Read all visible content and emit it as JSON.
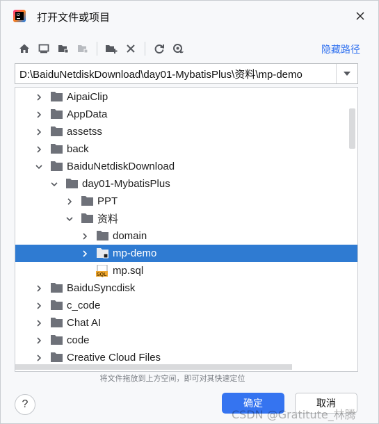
{
  "title": "打开文件或项目",
  "toolbar": {
    "hidden_path_label": "隐藏路径"
  },
  "path": {
    "value": "D:\\BaiduNetdiskDownload\\day01-MybatisPlus\\资料\\mp-demo"
  },
  "tree": {
    "items": [
      {
        "label": "AipaiClip"
      },
      {
        "label": "AppData"
      },
      {
        "label": "assetss"
      },
      {
        "label": "back"
      },
      {
        "label": "BaiduNetdiskDownload"
      },
      {
        "label": "day01-MybatisPlus"
      },
      {
        "label": "PPT"
      },
      {
        "label": "资料"
      },
      {
        "label": "domain"
      },
      {
        "label": "mp-demo"
      },
      {
        "label": "mp.sql"
      },
      {
        "label": "BaiduSyncdisk"
      },
      {
        "label": "c_code"
      },
      {
        "label": "Chat AI"
      },
      {
        "label": "code"
      },
      {
        "label": "Creative Cloud Files"
      }
    ]
  },
  "hint": "将文件拖放到上方空间，即可对其快速定位",
  "buttons": {
    "ok": "确定",
    "cancel": "取消",
    "help": "?"
  },
  "watermark": "CSDN @Gratitute_林腾",
  "colors": {
    "accent": "#3574f0",
    "selection": "#2f7bd2",
    "folder": "#6e7179"
  }
}
